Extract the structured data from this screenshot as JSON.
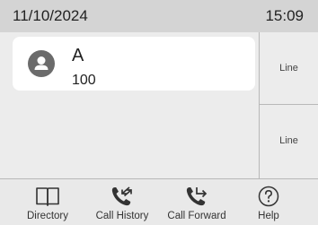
{
  "status_bar": {
    "date": "11/10/2024",
    "time": "15:09"
  },
  "contact": {
    "name": "A",
    "number": "100",
    "avatar_icon": "user-avatar-icon"
  },
  "line_keys": [
    {
      "label": "Line"
    },
    {
      "label": "Line"
    }
  ],
  "softkeys": [
    {
      "label": "Directory",
      "icon": "book-icon"
    },
    {
      "label": "Call History",
      "icon": "call-history-icon"
    },
    {
      "label": "Call Forward",
      "icon": "call-forward-icon"
    },
    {
      "label": "Help",
      "icon": "help-icon"
    }
  ],
  "colors": {
    "status_bar_bg": "#d4d4d4",
    "screen_bg": "#ececec",
    "card_bg": "#ffffff",
    "avatar": "#6b6b6b"
  }
}
